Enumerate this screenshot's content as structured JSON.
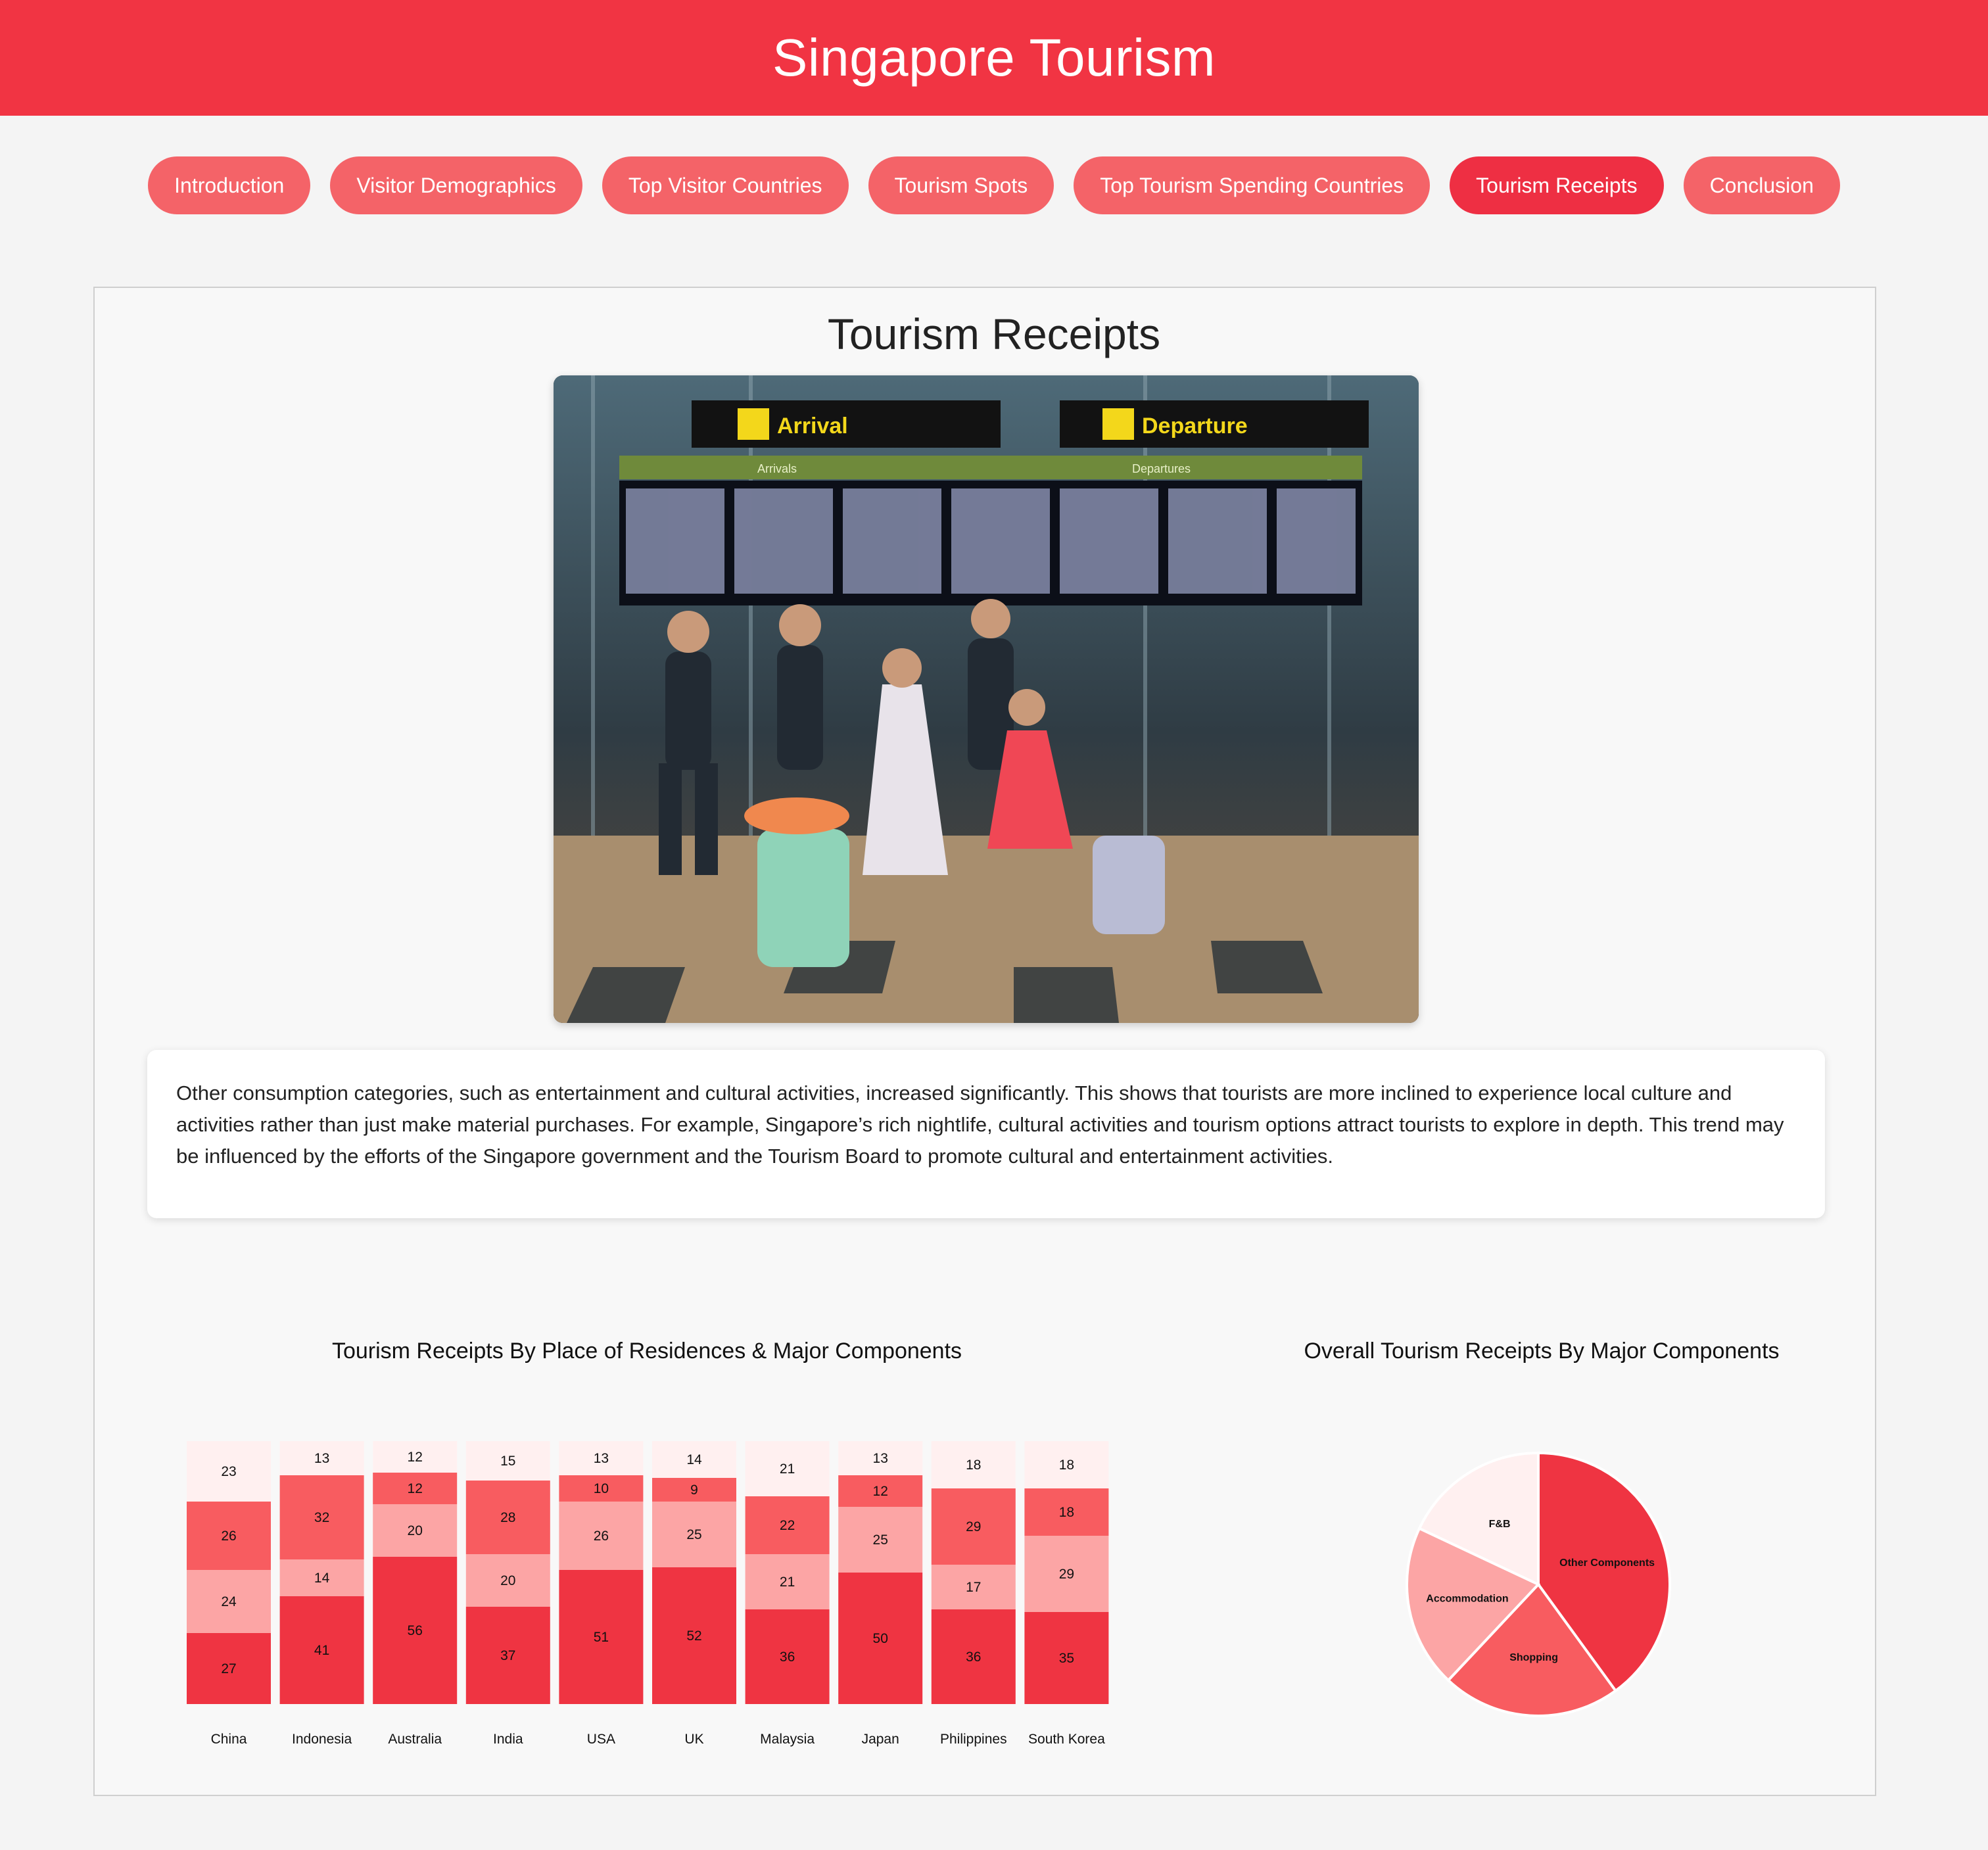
{
  "header": {
    "title": "Singapore Tourism"
  },
  "nav": {
    "items": [
      {
        "label": "Introduction",
        "active": false
      },
      {
        "label": "Visitor Demographics",
        "active": false
      },
      {
        "label": "Top Visitor Countries",
        "active": false
      },
      {
        "label": "Tourism Spots",
        "active": false
      },
      {
        "label": "Top Tourism Spending Countries",
        "active": false
      },
      {
        "label": "Tourism Receipts",
        "active": true
      },
      {
        "label": "Conclusion",
        "active": false
      }
    ]
  },
  "section": {
    "title": "Tourism Receipts",
    "paragraph": "Other consumption categories, such as entertainment and cultural activities, increased significantly. This shows that tourists are more inclined to experience local culture and activities rather than just make material purchases. For example, Singapore’s rich nightlife, cultural activities and tourism options attract tourists to explore in depth. This trend may be influenced by the efforts of the Singapore government and the Tourism Board to promote cultural and entertainment activities.",
    "photo_signs": {
      "arrival": "Arrival",
      "departure": "Departure",
      "arrivals": "Arrivals",
      "departures": "Departures"
    }
  },
  "colors": {
    "brand": "#f13443",
    "nav_button": "#f46368",
    "nav_active": "#ee2f43",
    "series": [
      "#ef3442",
      "#fca5a5",
      "#f85c60",
      "#fff0f0"
    ]
  },
  "chart_data": [
    {
      "type": "bar",
      "stacked": true,
      "title": "Tourism Receipts By Place of Residences & Major Components",
      "categories": [
        "China",
        "Indonesia",
        "Australia",
        "India",
        "USA",
        "UK",
        "Malaysia",
        "Japan",
        "Philippines",
        "South Korea"
      ],
      "series": [
        {
          "values": [
            27,
            41,
            56,
            37,
            51,
            52,
            36,
            50,
            36,
            35
          ]
        },
        {
          "values": [
            24,
            14,
            20,
            20,
            26,
            25,
            21,
            25,
            17,
            29
          ]
        },
        {
          "values": [
            26,
            32,
            12,
            28,
            10,
            9,
            22,
            12,
            29,
            18
          ]
        },
        {
          "values": [
            23,
            13,
            12,
            15,
            13,
            14,
            21,
            13,
            18,
            18
          ]
        }
      ],
      "ylim": [
        0,
        100
      ],
      "grid": false,
      "legend": "none"
    },
    {
      "type": "pie",
      "title": "Overall Tourism Receipts By Major Components",
      "labels": [
        "Other Components",
        "Shopping",
        "Accommodation",
        "F&B"
      ],
      "values": [
        40,
        22,
        20,
        18
      ]
    }
  ]
}
